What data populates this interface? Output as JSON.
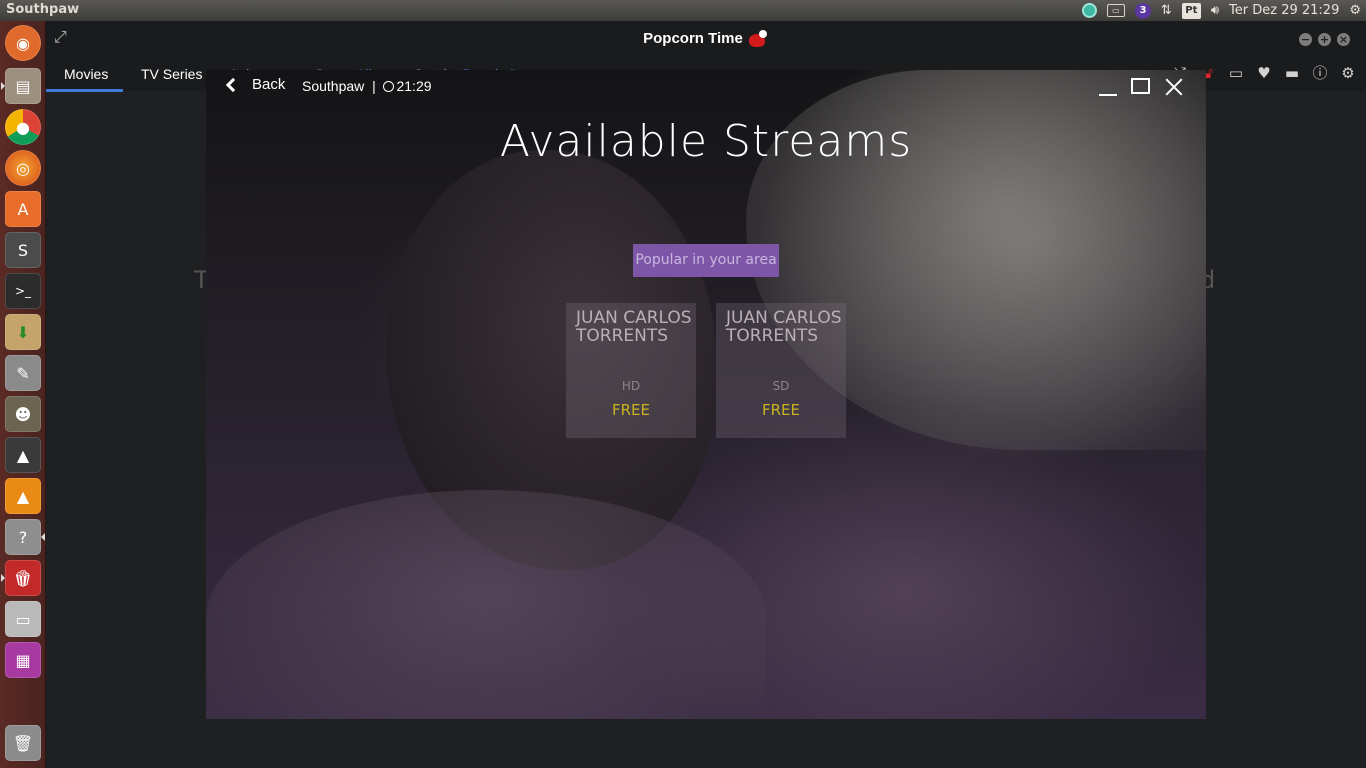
{
  "panel": {
    "window_title": "Southpaw",
    "datetime": "Ter Dez 29 21:29",
    "indicator_badge": "3",
    "keyboard_layout": "Pt"
  },
  "launcher": {
    "items": [
      "ubuntu-dash",
      "file-manager",
      "chrome",
      "firefox",
      "software-center",
      "sublime-text",
      "terminal",
      "archive-manager",
      "system-settings",
      "gimp",
      "inkscape",
      "vlc",
      "help",
      "popcorn-time",
      "drive",
      "workspace-switcher",
      "trash"
    ]
  },
  "app": {
    "title": "Popcorn Time",
    "nav": {
      "movies": "Movies",
      "tv_series": "TV Series",
      "anime": "Anime",
      "genre_label": "Genre",
      "genre_value": "All",
      "sort_label": "Sort by",
      "sort_value": "Popularity"
    },
    "bg_left": "T",
    "bg_right": "d"
  },
  "overlay": {
    "back_label": "Back",
    "movie_title": "Southpaw",
    "separator": "|",
    "time": "21:29",
    "heading": "Available Streams",
    "popular_label": "Popular in your area",
    "streams": [
      {
        "provider": "JUAN CARLOS TORRENTS",
        "quality": "HD",
        "price": "FREE"
      },
      {
        "provider": "JUAN CARLOS TORRENTS",
        "quality": "SD",
        "price": "FREE"
      }
    ]
  },
  "colors": {
    "accent_blue": "#3d7bd6",
    "popular_purple": "#7e56a8",
    "price_gold": "#c9b21e",
    "lock_red": "#e0262a"
  }
}
